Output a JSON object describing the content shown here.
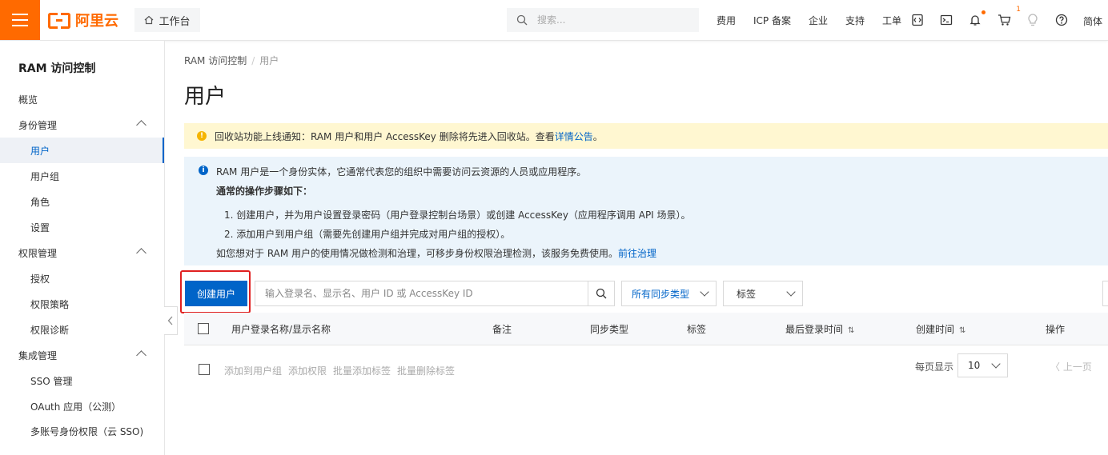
{
  "topbar": {
    "logo_text": "阿里云",
    "workbench": "工作台",
    "search_placeholder": "搜索...",
    "links": [
      "费用",
      "ICP 备案",
      "企业",
      "支持",
      "工单"
    ],
    "cart_badge": "1",
    "language": "简体",
    "accent_color": "#ff6a00"
  },
  "sidebar": {
    "title": "RAM 访问控制",
    "items": [
      {
        "label": "概览",
        "level": 1
      },
      {
        "label": "身份管理",
        "level": 1,
        "expanded": true
      },
      {
        "label": "用户",
        "level": 2,
        "active": true
      },
      {
        "label": "用户组",
        "level": 2
      },
      {
        "label": "角色",
        "level": 2
      },
      {
        "label": "设置",
        "level": 2
      },
      {
        "label": "权限管理",
        "level": 1,
        "expanded": true
      },
      {
        "label": "授权",
        "level": 2
      },
      {
        "label": "权限策略",
        "level": 2
      },
      {
        "label": "权限诊断",
        "level": 2
      },
      {
        "label": "集成管理",
        "level": 1,
        "expanded": true
      },
      {
        "label": "SSO 管理",
        "level": 2
      },
      {
        "label": "OAuth 应用（公测）",
        "level": 2
      },
      {
        "label": "多账号身份权限（云 SSO)",
        "level": 2
      }
    ]
  },
  "main": {
    "breadcrumb": [
      "RAM 访问控制",
      "用户"
    ],
    "title": "用户",
    "notice": {
      "text": "回收站功能上线通知：RAM 用户和用户 AccessKey 删除将先进入回收站。查看",
      "link": "详情公告",
      "suffix": "。"
    },
    "info": {
      "line1": "RAM 用户是一个身份实体，它通常代表您的组织中需要访问云资源的人员或应用程序。",
      "heading": "通常的操作步骤如下：",
      "step1": "1. 创建用户，并为用户设置登录密码（用户登录控制台场景）或创建 AccessKey（应用程序调用 API 场景）。",
      "step2": "2. 添加用户到用户组（需要先创建用户组并完成对用户组的授权）。",
      "footer": "如您想对于 RAM 用户的使用情况做检测和治理，可移步身份权限治理检测，该服务免费使用。",
      "footer_link": "前往治理"
    },
    "toolbar": {
      "create_button": "创建用户",
      "search_placeholder": "输入登录名、显示名、用户 ID 或 AccessKey ID",
      "sync_filter": "所有同步类型",
      "tag_filter": "标签"
    },
    "table": {
      "columns": [
        "用户登录名称/显示名称",
        "备注",
        "同步类型",
        "标签",
        "最后登录时间",
        "创建时间",
        "操作"
      ]
    },
    "batch_actions": [
      "添加到用户组",
      "添加权限",
      "批量添加标签",
      "批量删除标签"
    ],
    "pagination": {
      "per_page_label": "每页显示",
      "per_page_value": "10",
      "prev": "上一页"
    }
  }
}
